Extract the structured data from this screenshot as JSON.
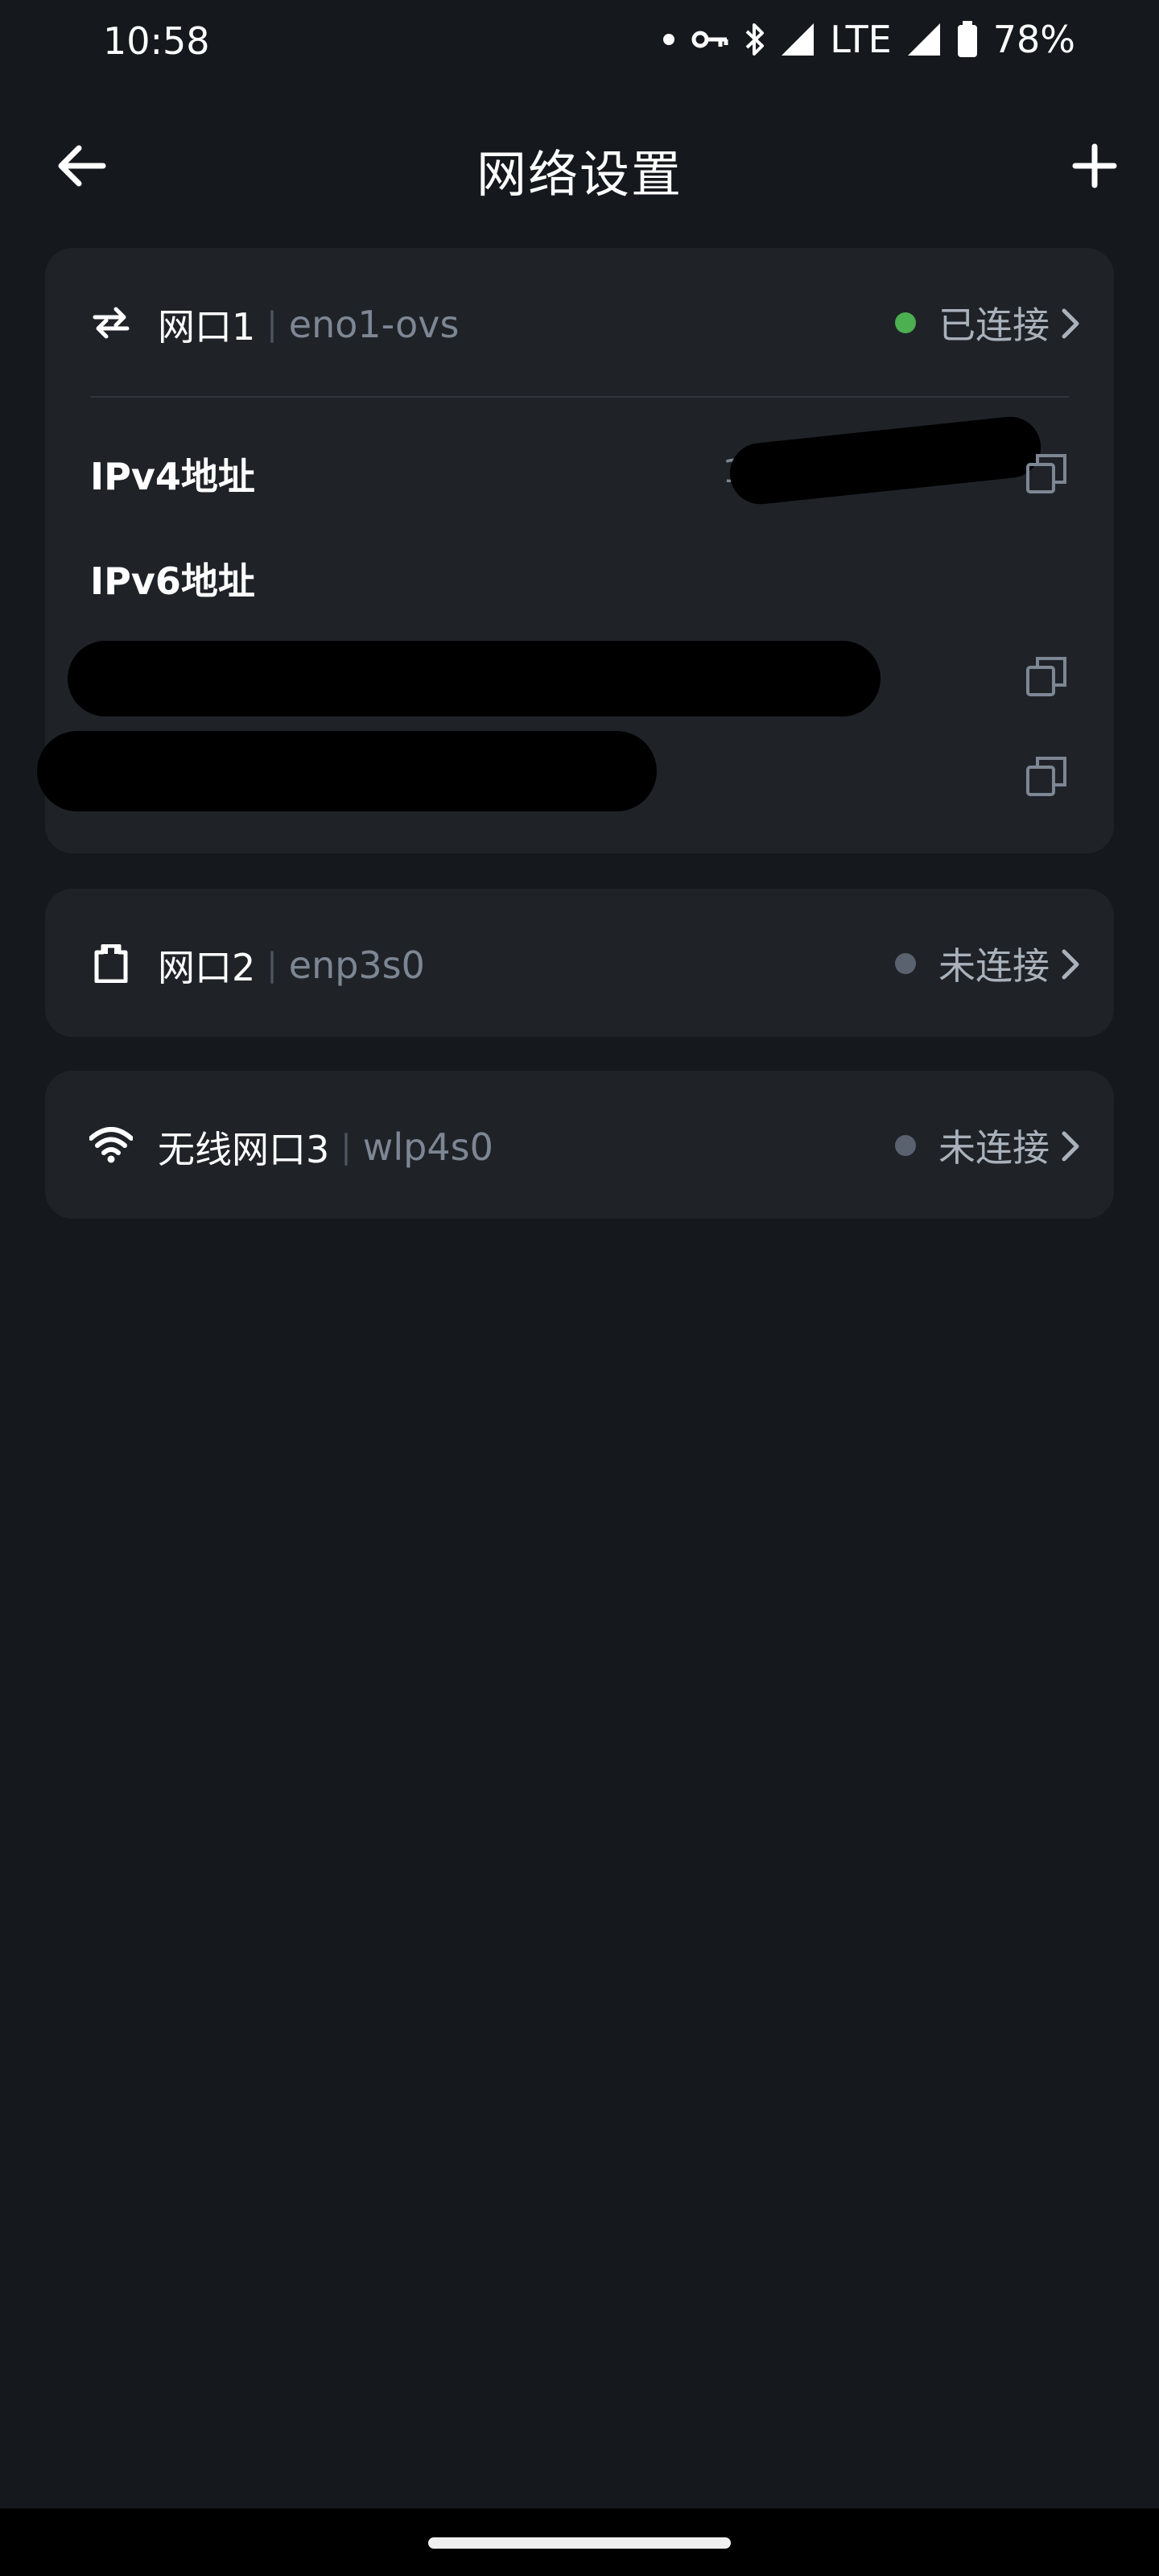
{
  "status_bar": {
    "time": "10:58",
    "network": "LTE",
    "battery": "78%"
  },
  "app_bar": {
    "title": "网络设置"
  },
  "interfaces": [
    {
      "icon": "swap-arrows-icon",
      "name": "网口1",
      "device": "eno1-ovs",
      "status": "已连接",
      "status_color": "#4caf50",
      "ipv4_label": "IPv4地址",
      "ipv4_value": "192",
      "ipv6_label": "IPv6地址"
    },
    {
      "icon": "ethernet-port-icon",
      "name": "网口2",
      "device": "enp3s0",
      "status": "未连接",
      "status_color": "#5a6270"
    },
    {
      "icon": "wifi-icon",
      "name": "无线网口3",
      "device": "wlp4s0",
      "status": "未连接",
      "status_color": "#5a6270"
    }
  ],
  "separator": "|"
}
